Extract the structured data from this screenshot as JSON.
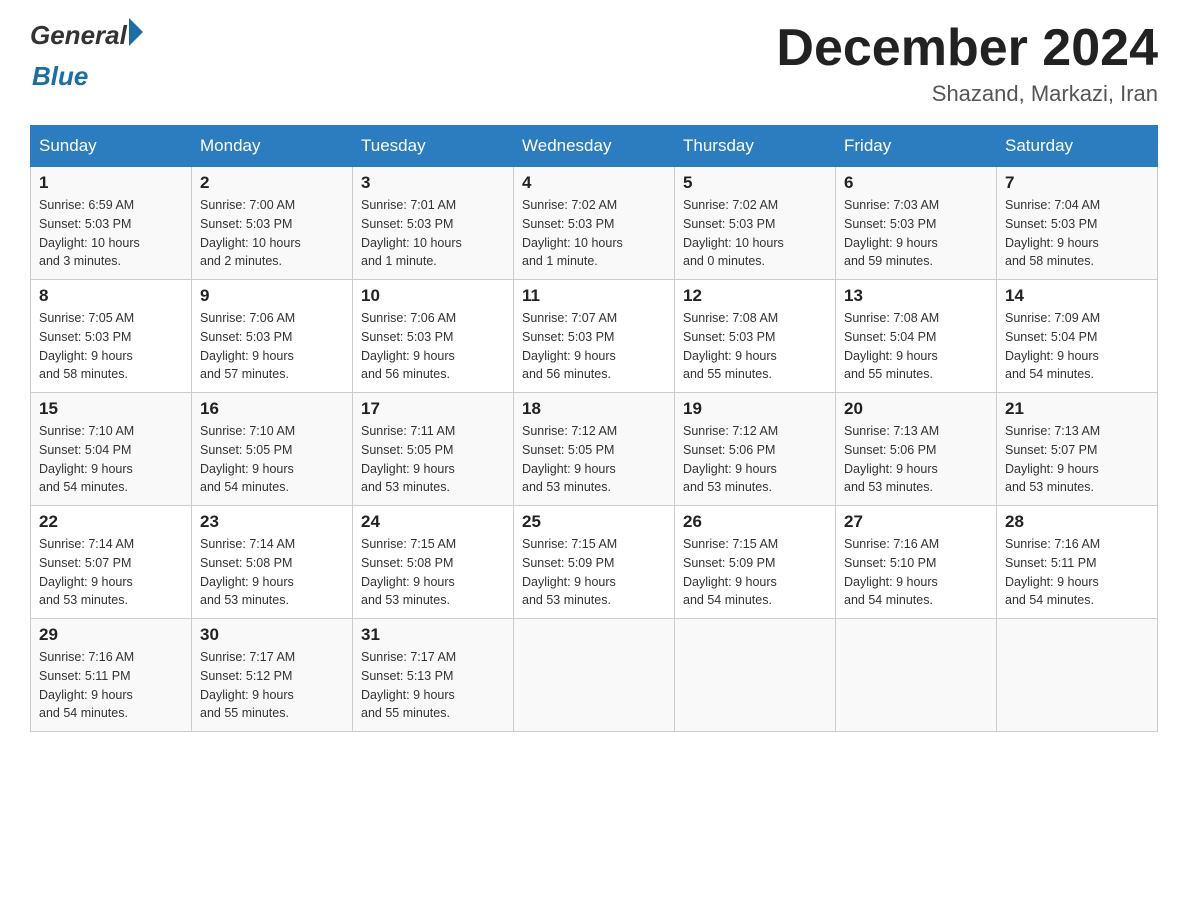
{
  "header": {
    "logo_text_general": "General",
    "logo_text_blue": "Blue",
    "month_title": "December 2024",
    "location": "Shazand, Markazi, Iran"
  },
  "weekdays": [
    "Sunday",
    "Monday",
    "Tuesday",
    "Wednesday",
    "Thursday",
    "Friday",
    "Saturday"
  ],
  "weeks": [
    [
      {
        "day": "1",
        "sunrise": "6:59 AM",
        "sunset": "5:03 PM",
        "daylight": "10 hours and 3 minutes."
      },
      {
        "day": "2",
        "sunrise": "7:00 AM",
        "sunset": "5:03 PM",
        "daylight": "10 hours and 2 minutes."
      },
      {
        "day": "3",
        "sunrise": "7:01 AM",
        "sunset": "5:03 PM",
        "daylight": "10 hours and 1 minute."
      },
      {
        "day": "4",
        "sunrise": "7:02 AM",
        "sunset": "5:03 PM",
        "daylight": "10 hours and 1 minute."
      },
      {
        "day": "5",
        "sunrise": "7:02 AM",
        "sunset": "5:03 PM",
        "daylight": "10 hours and 0 minutes."
      },
      {
        "day": "6",
        "sunrise": "7:03 AM",
        "sunset": "5:03 PM",
        "daylight": "9 hours and 59 minutes."
      },
      {
        "day": "7",
        "sunrise": "7:04 AM",
        "sunset": "5:03 PM",
        "daylight": "9 hours and 58 minutes."
      }
    ],
    [
      {
        "day": "8",
        "sunrise": "7:05 AM",
        "sunset": "5:03 PM",
        "daylight": "9 hours and 58 minutes."
      },
      {
        "day": "9",
        "sunrise": "7:06 AM",
        "sunset": "5:03 PM",
        "daylight": "9 hours and 57 minutes."
      },
      {
        "day": "10",
        "sunrise": "7:06 AM",
        "sunset": "5:03 PM",
        "daylight": "9 hours and 56 minutes."
      },
      {
        "day": "11",
        "sunrise": "7:07 AM",
        "sunset": "5:03 PM",
        "daylight": "9 hours and 56 minutes."
      },
      {
        "day": "12",
        "sunrise": "7:08 AM",
        "sunset": "5:03 PM",
        "daylight": "9 hours and 55 minutes."
      },
      {
        "day": "13",
        "sunrise": "7:08 AM",
        "sunset": "5:04 PM",
        "daylight": "9 hours and 55 minutes."
      },
      {
        "day": "14",
        "sunrise": "7:09 AM",
        "sunset": "5:04 PM",
        "daylight": "9 hours and 54 minutes."
      }
    ],
    [
      {
        "day": "15",
        "sunrise": "7:10 AM",
        "sunset": "5:04 PM",
        "daylight": "9 hours and 54 minutes."
      },
      {
        "day": "16",
        "sunrise": "7:10 AM",
        "sunset": "5:05 PM",
        "daylight": "9 hours and 54 minutes."
      },
      {
        "day": "17",
        "sunrise": "7:11 AM",
        "sunset": "5:05 PM",
        "daylight": "9 hours and 53 minutes."
      },
      {
        "day": "18",
        "sunrise": "7:12 AM",
        "sunset": "5:05 PM",
        "daylight": "9 hours and 53 minutes."
      },
      {
        "day": "19",
        "sunrise": "7:12 AM",
        "sunset": "5:06 PM",
        "daylight": "9 hours and 53 minutes."
      },
      {
        "day": "20",
        "sunrise": "7:13 AM",
        "sunset": "5:06 PM",
        "daylight": "9 hours and 53 minutes."
      },
      {
        "day": "21",
        "sunrise": "7:13 AM",
        "sunset": "5:07 PM",
        "daylight": "9 hours and 53 minutes."
      }
    ],
    [
      {
        "day": "22",
        "sunrise": "7:14 AM",
        "sunset": "5:07 PM",
        "daylight": "9 hours and 53 minutes."
      },
      {
        "day": "23",
        "sunrise": "7:14 AM",
        "sunset": "5:08 PM",
        "daylight": "9 hours and 53 minutes."
      },
      {
        "day": "24",
        "sunrise": "7:15 AM",
        "sunset": "5:08 PM",
        "daylight": "9 hours and 53 minutes."
      },
      {
        "day": "25",
        "sunrise": "7:15 AM",
        "sunset": "5:09 PM",
        "daylight": "9 hours and 53 minutes."
      },
      {
        "day": "26",
        "sunrise": "7:15 AM",
        "sunset": "5:09 PM",
        "daylight": "9 hours and 54 minutes."
      },
      {
        "day": "27",
        "sunrise": "7:16 AM",
        "sunset": "5:10 PM",
        "daylight": "9 hours and 54 minutes."
      },
      {
        "day": "28",
        "sunrise": "7:16 AM",
        "sunset": "5:11 PM",
        "daylight": "9 hours and 54 minutes."
      }
    ],
    [
      {
        "day": "29",
        "sunrise": "7:16 AM",
        "sunset": "5:11 PM",
        "daylight": "9 hours and 54 minutes."
      },
      {
        "day": "30",
        "sunrise": "7:17 AM",
        "sunset": "5:12 PM",
        "daylight": "9 hours and 55 minutes."
      },
      {
        "day": "31",
        "sunrise": "7:17 AM",
        "sunset": "5:13 PM",
        "daylight": "9 hours and 55 minutes."
      },
      null,
      null,
      null,
      null
    ]
  ],
  "labels": {
    "sunrise": "Sunrise:",
    "sunset": "Sunset:",
    "daylight": "Daylight:"
  }
}
